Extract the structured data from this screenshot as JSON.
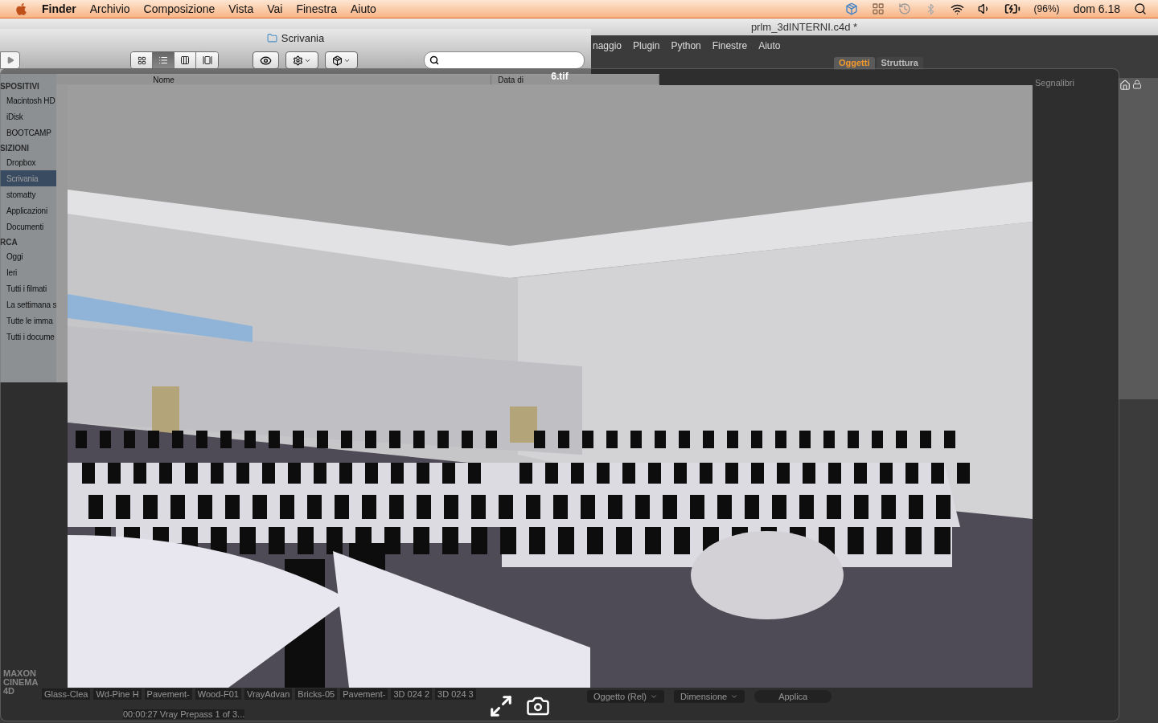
{
  "menu_bar": {
    "app": "Finder",
    "menus": [
      "Archivio",
      "Composizione",
      "Vista",
      "Vai",
      "Finestra",
      "Aiuto"
    ],
    "battery": "(96%)",
    "clock": "dom 6.18"
  },
  "c4d_window": {
    "title": "prlm_3dINTERNI.c4d *",
    "menus": [
      "naggio",
      "Plugin",
      "Python",
      "Finestre",
      "Aiuto"
    ],
    "tabs": [
      {
        "label": "Oggetti",
        "selected": true
      },
      {
        "label": "Struttura",
        "selected": false
      }
    ],
    "bookmarks": "Segnalibri",
    "materials": [
      "Glass-Clea",
      "Wd-Pine H",
      "Pavement-",
      "Wood-F01",
      "VrayAdvan",
      "Bricks-05",
      "Pavement-",
      "3D 024 2",
      "3D 024 3"
    ],
    "status": "00:00:27 Vray Prepass 1 of 3...",
    "dropdowns": [
      "Oggetto (Rel)",
      "Dimensione"
    ],
    "apply_button": "Applica",
    "brand": "MAXON CINEMA 4D"
  },
  "finder_window": {
    "title": "Scrivania",
    "views": [
      {
        "kind": "icons",
        "selected": false
      },
      {
        "kind": "list",
        "selected": true
      },
      {
        "kind": "columns",
        "selected": false
      },
      {
        "kind": "coverflow",
        "selected": false
      }
    ],
    "columns": [
      "Nome",
      "Data di"
    ],
    "sidebar": [
      {
        "heading": "SPOSITIVI",
        "items": [
          {
            "label": "Macintosh HD",
            "selected": false
          },
          {
            "label": "iDisk",
            "selected": false
          },
          {
            "label": "BOOTCAMP",
            "selected": false
          }
        ]
      },
      {
        "heading": "SIZIONI",
        "items": [
          {
            "label": "Dropbox",
            "selected": false
          },
          {
            "label": "Scrivania",
            "selected": true
          },
          {
            "label": "stomatty",
            "selected": false
          },
          {
            "label": "Applicazioni",
            "selected": false
          },
          {
            "label": "Documenti",
            "selected": false
          }
        ]
      },
      {
        "heading": "RCA",
        "items": [
          {
            "label": "Oggi",
            "selected": false
          },
          {
            "label": "Ieri",
            "selected": false
          },
          {
            "label": "Tutti i filmati",
            "selected": false
          },
          {
            "label": "La settimana s",
            "selected": false
          },
          {
            "label": "Tutte le imma",
            "selected": false
          },
          {
            "label": "Tutti i docume",
            "selected": false
          }
        ]
      }
    ]
  },
  "quick_look": {
    "title": "6.tif"
  }
}
